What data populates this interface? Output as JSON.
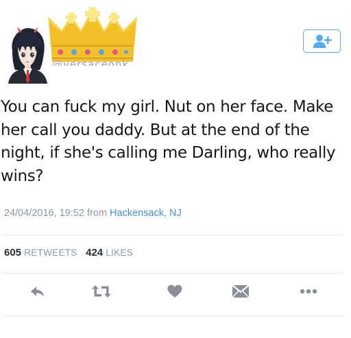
{
  "tweet": {
    "handle_fragment": "@versaceonk",
    "text": "You can fuck my girl. Nut on her face. Make her call you daddy. But at the end of the night, if she's calling me Darling, who really wins?",
    "timestamp": "24/04/2016, 19:52",
    "from_label": "from",
    "location": "Hackensack, NJ",
    "retweets_count": "605",
    "retweets_label": "RETWEETS",
    "likes_count": "424",
    "likes_label": "LIKES"
  },
  "header": {
    "avatar_icon": "anime-avatar",
    "crown_icon": "crown-icon",
    "follow_icon": "add-user-icon"
  },
  "actions": [
    {
      "name": "reply",
      "icon": "reply-icon"
    },
    {
      "name": "retweet",
      "icon": "retweet-icon"
    },
    {
      "name": "like",
      "icon": "heart-icon"
    },
    {
      "name": "direct-message",
      "icon": "envelope-icon"
    },
    {
      "name": "more",
      "icon": "more-icon"
    }
  ],
  "colors": {
    "accent": "#55acee",
    "link": "#3b94d9",
    "muted": "#8899a6",
    "text": "#14171a",
    "crown_gold": "#f2c431",
    "divider": "#e1e8ed"
  }
}
